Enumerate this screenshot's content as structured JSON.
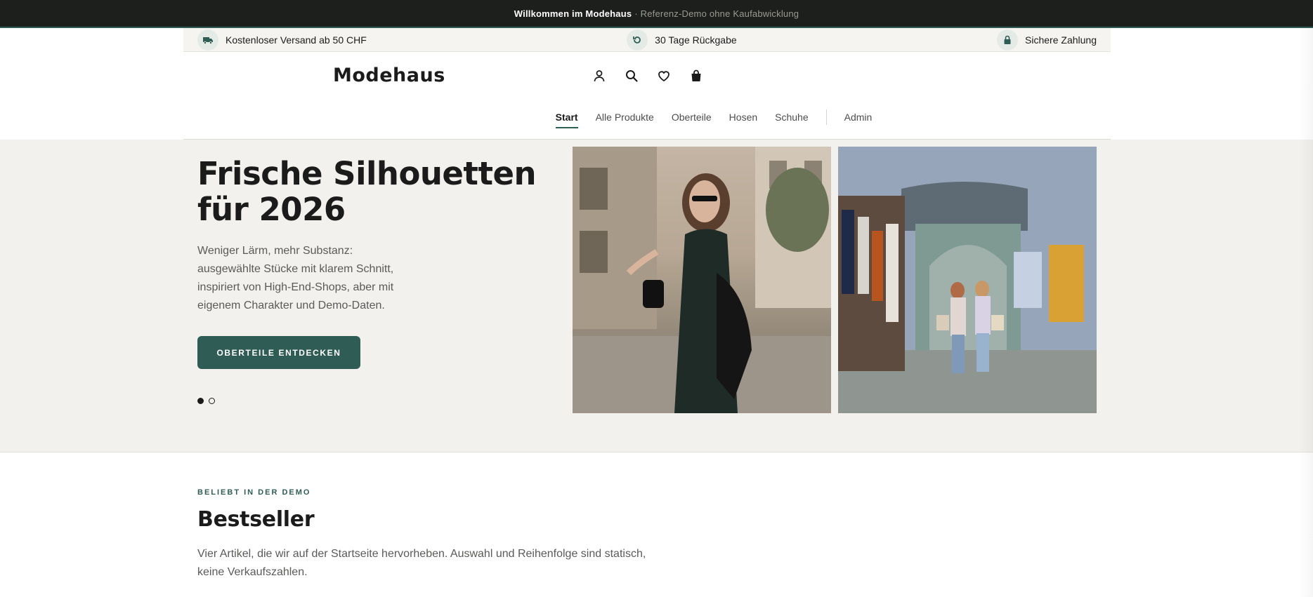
{
  "announcement": {
    "strong": "Willkommen im Modehaus",
    "muted": "· Referenz-Demo ohne Kaufabwicklung"
  },
  "benefits": [
    {
      "icon": "truck-icon",
      "label": "Kostenloser Versand ab 50 CHF"
    },
    {
      "icon": "return-icon",
      "label": "30 Tage Rückgabe"
    },
    {
      "icon": "lock-icon",
      "label": "Sichere Zahlung"
    }
  ],
  "header": {
    "logo": "Modehaus",
    "icons": [
      "account-icon",
      "search-icon",
      "heart-icon",
      "bag-icon"
    ]
  },
  "nav": {
    "items": [
      "Start",
      "Alle Produkte",
      "Oberteile",
      "Hosen",
      "Schuhe",
      "Admin"
    ],
    "active": "Start"
  },
  "hero": {
    "title": "Frische Silhouetten für 2026",
    "text": "Weniger Lärm, mehr Substanz: ausgewählte Stücke mit klarem Schnitt, inspiriert von High-End-Shops, aber mit eigenem Charakter und Demo-Daten.",
    "cta": "OBERTEILE ENTDECKEN",
    "slides": 2,
    "active_slide": 1
  },
  "bestseller": {
    "eyebrow": "BELIEBT IN DER DEMO",
    "title": "Bestseller",
    "text": "Vier Artikel, die wir auf der Startseite hervorheben. Auswahl und Reihenfolge sind statisch, keine Verkaufszahlen."
  },
  "colors": {
    "accent": "#2f5d55",
    "dark": "#1d1f1c",
    "hero_bg": "#f3f1ed"
  }
}
